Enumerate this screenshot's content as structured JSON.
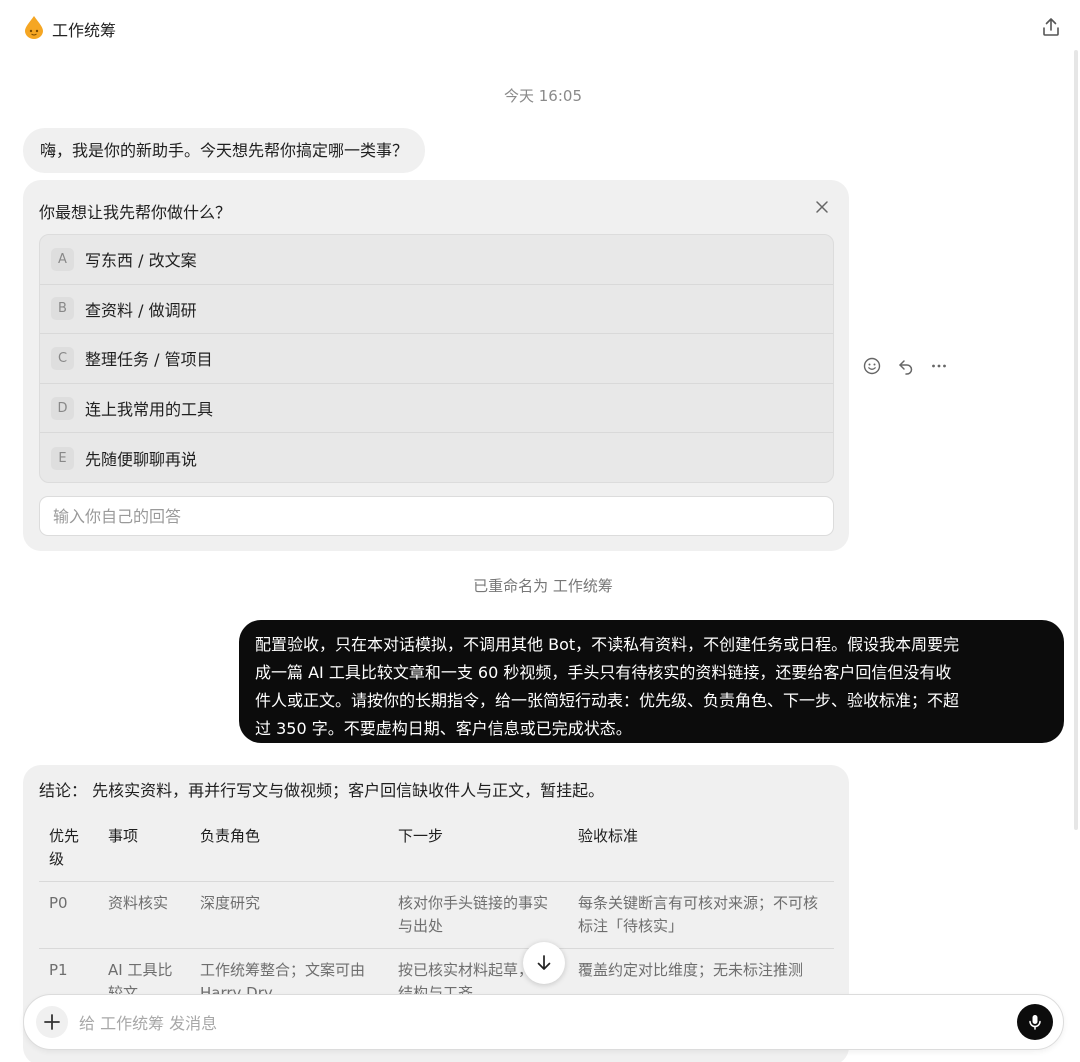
{
  "header": {
    "title": "工作统筹"
  },
  "timestamp": "今天 16:05",
  "greeting": "嗨，我是你的新助手。今天想先帮你搞定哪一类事？",
  "question": {
    "title": "你最想让我先帮你做什么？",
    "options": [
      {
        "key": "A",
        "label": "写东西 / 改文案"
      },
      {
        "key": "B",
        "label": "查资料 / 做调研"
      },
      {
        "key": "C",
        "label": "整理任务 / 管项目"
      },
      {
        "key": "D",
        "label": "连上我常用的工具"
      },
      {
        "key": "E",
        "label": "先随便聊聊再说"
      }
    ],
    "answer_placeholder": "输入你自己的回答"
  },
  "renamed_notice": "已重命名为 工作统筹",
  "user_message": {
    "lines": [
      "配置验收，只在本对话模拟，不调用其他 Bot，不读私有资料，不创建任务或日程。假设我本周要完",
      "成一篇 AI 工具比较文章和一支 60 秒视频，手头只有待核实的资料链接，还要给客户回信但没有收",
      "件人或正文。请按你的长期指令，给一张简短行动表：优先级、负责角色、下一步、验收标准；不超",
      "过 350 字。不要虚构日期、客户信息或已完成状态。"
    ]
  },
  "response": {
    "conclusion": "结论： 先核实资料，再并行写文与做视频；客户回信缺收件人与正文，暂挂起。",
    "table": {
      "headers": [
        "优先级",
        "事项",
        "负责角色",
        "下一步",
        "验收标准"
      ],
      "rows": [
        [
          "P0",
          "资料核实",
          "深度研究",
          "核对你手头链接的事实与出处",
          "每条关键断言有可核对来源；不可核标注「待核实」"
        ],
        [
          "P1",
          "AI 工具比较文",
          "工作统筹整合；文案可由 Harry Dry",
          "按已核实材料起草，统结构与工齐",
          "覆盖约定对比维度；无未标注推测"
        ]
      ]
    }
  },
  "composer": {
    "placeholder": "给 工作统筹 发消息"
  },
  "colors": {
    "user_bubble": "#0c0c0c",
    "bot_bubble": "#f0f0f0",
    "logo": "#f5a623"
  }
}
